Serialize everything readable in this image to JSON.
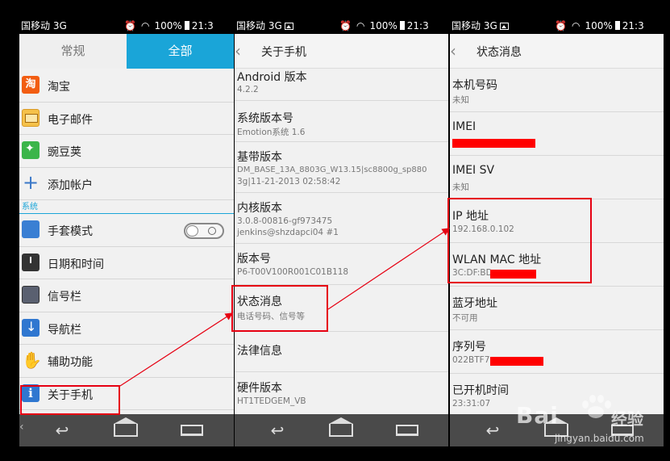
{
  "status_bar": {
    "carrier": "国移动 3G",
    "battery": "100%",
    "time": "21:3",
    "network_badge": "3G"
  },
  "panel1": {
    "tabs": [
      "常规",
      "全部"
    ],
    "items_top": [
      {
        "label": "淘宝",
        "icon": "taobao-icon"
      },
      {
        "label": "电子邮件",
        "icon": "mail-icon"
      },
      {
        "label": "豌豆荚",
        "icon": "wandoujia-icon"
      },
      {
        "label": "添加帐户",
        "icon": "add-icon"
      }
    ],
    "section_label": "系统",
    "items_system": [
      {
        "label": "手套模式",
        "icon": "glove-icon"
      },
      {
        "label": "日期和时间",
        "icon": "clock-icon"
      },
      {
        "label": "信号栏",
        "icon": "signal-icon"
      },
      {
        "label": "导航栏",
        "icon": "navbar-icon"
      },
      {
        "label": "辅助功能",
        "icon": "hand-icon"
      },
      {
        "label": "关于手机",
        "icon": "info-icon"
      }
    ],
    "toggle_on": false
  },
  "panel2": {
    "header_title": "关于手机",
    "rows": [
      {
        "title": "Android 版本",
        "sub": "4.2.2"
      },
      {
        "title": "系统版本号",
        "sub": "Emotion系统 1.6"
      },
      {
        "title": "基带版本",
        "sub": "DM_BASE_13A_8803G_W13.15|sc8800g_sp880",
        "sub2": "3g|11-21-2013 02:58:42"
      },
      {
        "title": "内核版本",
        "sub": "3.0.8-00816-gf973475",
        "sub2": "jenkins@shzdapci04 #1"
      },
      {
        "title": "版本号",
        "sub": "P6-T00V100R001C01B118"
      },
      {
        "title": "状态消息",
        "sub": "电话号码、信号等"
      },
      {
        "title": "法律信息",
        "sub": ""
      },
      {
        "title": "硬件版本",
        "sub": "HT1TEDGEM_VB"
      }
    ]
  },
  "panel3": {
    "header_title": "状态消息",
    "rows": [
      {
        "title": "本机号码",
        "sub": "未知"
      },
      {
        "title": "IMEI",
        "sub": ""
      },
      {
        "title": "IMEI SV",
        "sub": "未知"
      },
      {
        "title": "IP 地址",
        "sub": "192.168.0.102"
      },
      {
        "title": "WLAN MAC 地址",
        "sub": "3C:DF:BD"
      },
      {
        "title": "蓝牙地址",
        "sub": "不可用"
      },
      {
        "title": "序列号",
        "sub": "022BTF7"
      },
      {
        "title": "已开机时间",
        "sub": "23:31:07"
      }
    ]
  },
  "watermark": {
    "brand": "Bai",
    "brand_suffix": "经验",
    "url": "jingyan.baidu.com"
  },
  "colors": {
    "accent": "#1aa5d8",
    "highlight": "#e60012",
    "redact": "#ff0000",
    "navbar": "#4a4a4a"
  }
}
